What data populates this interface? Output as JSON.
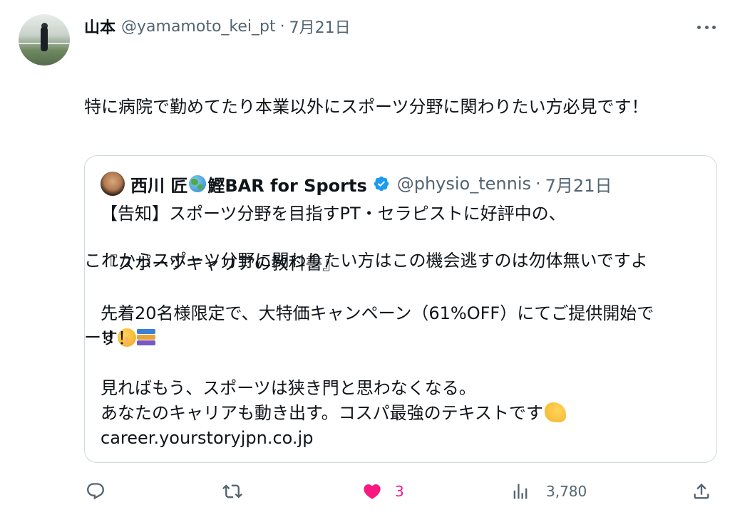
{
  "tweet": {
    "author_name": "山本",
    "handle": "@yamamoto_kei_pt",
    "separator": "·",
    "date": "7月21日",
    "lines": [
      "特に病院で勤めてたり本業以外にスポーツ分野に関わりたい方必見です！",
      "",
      "これからスポーツ分野に関わりたい方はこの機会逃すのは勿体無いですよ",
      "ー!!"
    ],
    "emoji_shush": "shushing-face-emoji"
  },
  "quote": {
    "author_name_1": "西川 匠",
    "globe": "globe-emoji",
    "author_name_2": "鰹BAR for Sports",
    "verified": "verified-badge",
    "handle": "@physio_tennis",
    "separator": "·",
    "date": "7月21日",
    "lines": [
      "【告知】スポーツ分野を目指すPT・セラピストに好評中の、",
      "",
      "『スポーツキャリアの教科書』",
      "",
      "先着20名様限定で、大特価キャンペーン（61%OFF）にてご提供開始で",
      "す！",
      "",
      "見ればもう、スポーツは狭き門と思わなくなる。",
      "あなたのキャリアも動き出す。コスパ最強のテキストです",
      "career.yourstoryjpn.co.jp"
    ]
  },
  "actions": {
    "reply_count": "",
    "retweet_count": "",
    "like_count": "3",
    "views_count": "3,780"
  },
  "colors": {
    "text": "#0f1419",
    "secondary": "#536471",
    "like": "#f91880",
    "verified": "#1d9bf0",
    "border": "#cfd9de"
  }
}
